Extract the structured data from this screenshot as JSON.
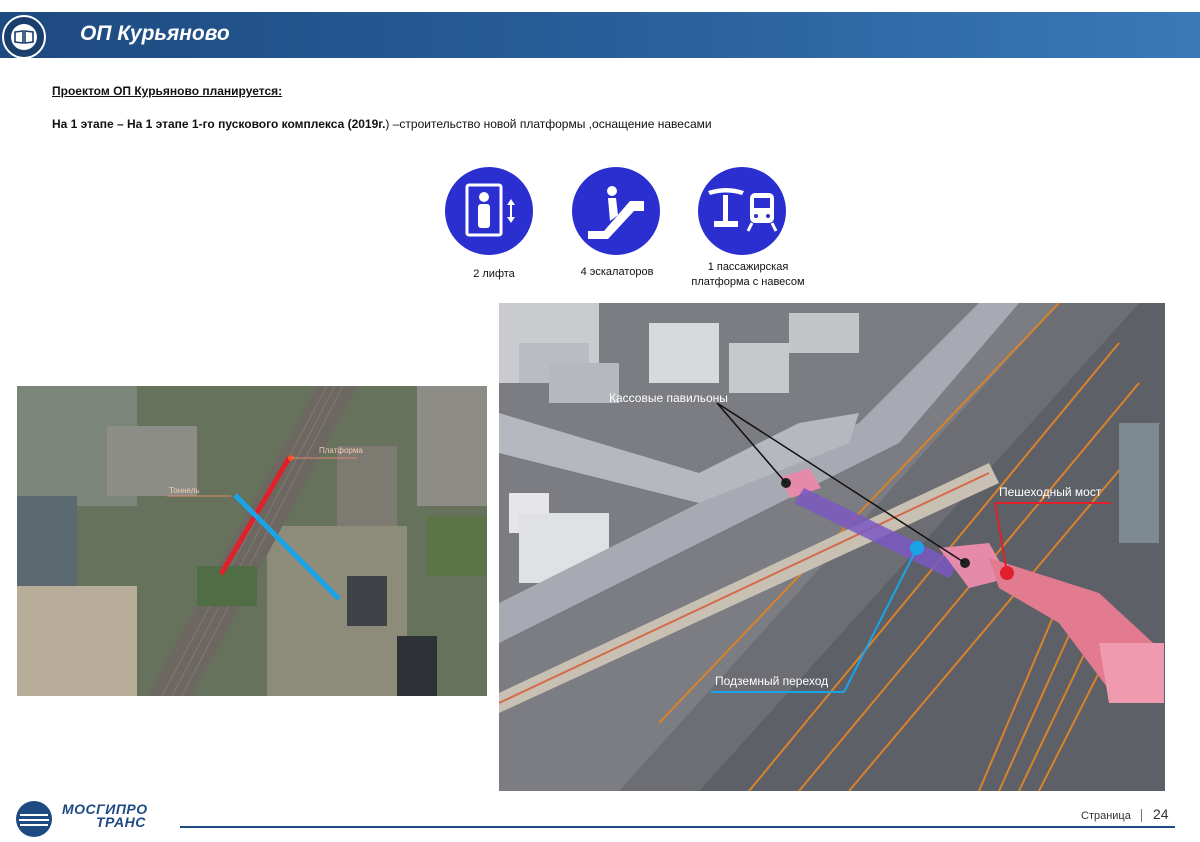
{
  "header": {
    "title": "ОП Курьяново"
  },
  "intro": "Проектом ОП Курьяново планируется:",
  "stage": {
    "bold": "На 1 этапе – На 1 этапе 1-го пускового комплекса (2019г.",
    "rest": ") –строительство новой платформы ,оснащение навесами"
  },
  "features": [
    {
      "icon": "elevator-icon",
      "label": "2 лифта"
    },
    {
      "icon": "escalator-icon",
      "label": "4 эскалаторов"
    },
    {
      "icon": "platform-canopy-icon",
      "label_line1": "1 пассажирская",
      "label_line2": "платформа с навесом"
    }
  ],
  "aerial_map": {
    "label_platform": "Платформа",
    "label_tunnel": "Тоннель"
  },
  "render_labels": {
    "ticket_pavilions": "Кассовые павильоны",
    "pedestrian_bridge": "Пешеходный мост",
    "underground_passage": "Подземный переход"
  },
  "colors": {
    "accent": "#2b2fd0",
    "header": "#1d4a80",
    "bridge": "#e21d2e",
    "tunnel": "#1aa3e8"
  },
  "footer": {
    "brand_line1": "МОСГИПРО",
    "brand_line2": "ТРАНС",
    "page_label": "Страница",
    "page_number": "24"
  }
}
